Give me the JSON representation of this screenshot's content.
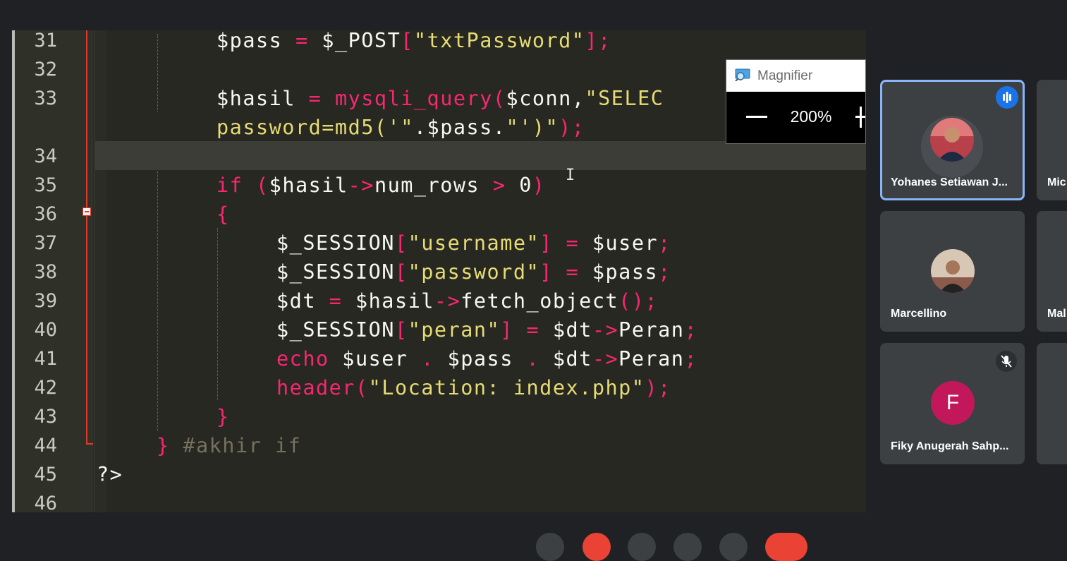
{
  "editor": {
    "lines": [
      {
        "n": "31",
        "tokens": [
          {
            "t": "$pass ",
            "c": "w"
          },
          {
            "t": "=",
            "c": "r"
          },
          {
            "t": " $_POST",
            "c": "w"
          },
          {
            "t": "[",
            "c": "r"
          },
          {
            "t": "\"txtPassword\"",
            "c": "s"
          },
          {
            "t": "];",
            "c": "r"
          }
        ]
      },
      {
        "n": "32",
        "tokens": []
      },
      {
        "n": "33",
        "tokens": [
          {
            "t": "$hasil ",
            "c": "w"
          },
          {
            "t": "=",
            "c": "r"
          },
          {
            "t": " ",
            "c": "w"
          },
          {
            "t": "mysqli_query",
            "c": "r"
          },
          {
            "t": "(",
            "c": "r"
          },
          {
            "t": "$conn,",
            "c": "w"
          },
          {
            "t": "\"SELEC",
            "c": "s"
          }
        ]
      },
      {
        "n": "",
        "tokens": [
          {
            "t": "password=md5('\"",
            "c": "s"
          },
          {
            "t": ".$pass.",
            "c": "w"
          },
          {
            "t": "\"')\"",
            "c": "s"
          },
          {
            "t": ");",
            "c": "r"
          }
        ]
      },
      {
        "n": "34",
        "tokens": []
      },
      {
        "n": "35",
        "tokens": [
          {
            "t": "if",
            "c": "r"
          },
          {
            "t": " (",
            "c": "r"
          },
          {
            "t": "$hasil",
            "c": "w"
          },
          {
            "t": "->",
            "c": "r"
          },
          {
            "t": "num_rows ",
            "c": "w"
          },
          {
            "t": ">",
            "c": "r"
          },
          {
            "t": " 0",
            "c": "w"
          },
          {
            "t": ")",
            "c": "r"
          }
        ]
      },
      {
        "n": "36",
        "tokens": [
          {
            "t": "{",
            "c": "r"
          }
        ]
      },
      {
        "n": "37",
        "tokens": [
          {
            "t": "$_SESSION",
            "c": "w"
          },
          {
            "t": "[",
            "c": "r"
          },
          {
            "t": "\"username\"",
            "c": "s"
          },
          {
            "t": "] = ",
            "c": "r"
          },
          {
            "t": "$user",
            "c": "w"
          },
          {
            "t": ";",
            "c": "r"
          }
        ]
      },
      {
        "n": "38",
        "tokens": [
          {
            "t": "$_SESSION",
            "c": "w"
          },
          {
            "t": "[",
            "c": "r"
          },
          {
            "t": "\"password\"",
            "c": "s"
          },
          {
            "t": "] = ",
            "c": "r"
          },
          {
            "t": "$pass",
            "c": "w"
          },
          {
            "t": ";",
            "c": "r"
          }
        ]
      },
      {
        "n": "39",
        "tokens": [
          {
            "t": "$dt ",
            "c": "w"
          },
          {
            "t": "=",
            "c": "r"
          },
          {
            "t": " $hasil",
            "c": "w"
          },
          {
            "t": "->",
            "c": "r"
          },
          {
            "t": "fetch_object",
            "c": "w"
          },
          {
            "t": "();",
            "c": "r"
          }
        ]
      },
      {
        "n": "40",
        "tokens": [
          {
            "t": "$_SESSION",
            "c": "w"
          },
          {
            "t": "[",
            "c": "r"
          },
          {
            "t": "\"peran\"",
            "c": "s"
          },
          {
            "t": "] = ",
            "c": "r"
          },
          {
            "t": "$dt",
            "c": "w"
          },
          {
            "t": "->",
            "c": "r"
          },
          {
            "t": "Peran",
            "c": "w"
          },
          {
            "t": ";",
            "c": "r"
          }
        ]
      },
      {
        "n": "41",
        "tokens": [
          {
            "t": "echo",
            "c": "r"
          },
          {
            "t": " $user ",
            "c": "w"
          },
          {
            "t": ".",
            "c": "r"
          },
          {
            "t": " $pass ",
            "c": "w"
          },
          {
            "t": ".",
            "c": "r"
          },
          {
            "t": " $dt",
            "c": "w"
          },
          {
            "t": "->",
            "c": "r"
          },
          {
            "t": "Peran",
            "c": "w"
          },
          {
            "t": ";",
            "c": "r"
          }
        ]
      },
      {
        "n": "42",
        "tokens": [
          {
            "t": "header",
            "c": "r"
          },
          {
            "t": "(",
            "c": "r"
          },
          {
            "t": "\"Location: index.php\"",
            "c": "s"
          },
          {
            "t": ");",
            "c": "r"
          }
        ]
      },
      {
        "n": "43",
        "tokens": [
          {
            "t": "}",
            "c": "r"
          }
        ]
      },
      {
        "n": "44",
        "tokens": [
          {
            "t": "}",
            "c": "r"
          },
          {
            "t": " #akhir if",
            "c": "g"
          }
        ]
      },
      {
        "n": "45",
        "tokens": [
          {
            "t": "?>",
            "c": "w"
          }
        ]
      },
      {
        "n": "46",
        "tokens": []
      }
    ]
  },
  "magnifier": {
    "title": "Magnifier",
    "zoom": "200%"
  },
  "participants": [
    {
      "name": "Yohanes Setiawan J...",
      "speaking": true
    },
    {
      "name": "Mic"
    },
    {
      "name": "Marcellino"
    },
    {
      "name": "Mal"
    },
    {
      "name": "Fiky Anugerah Sahp...",
      "initial": "F",
      "muted": true
    }
  ]
}
